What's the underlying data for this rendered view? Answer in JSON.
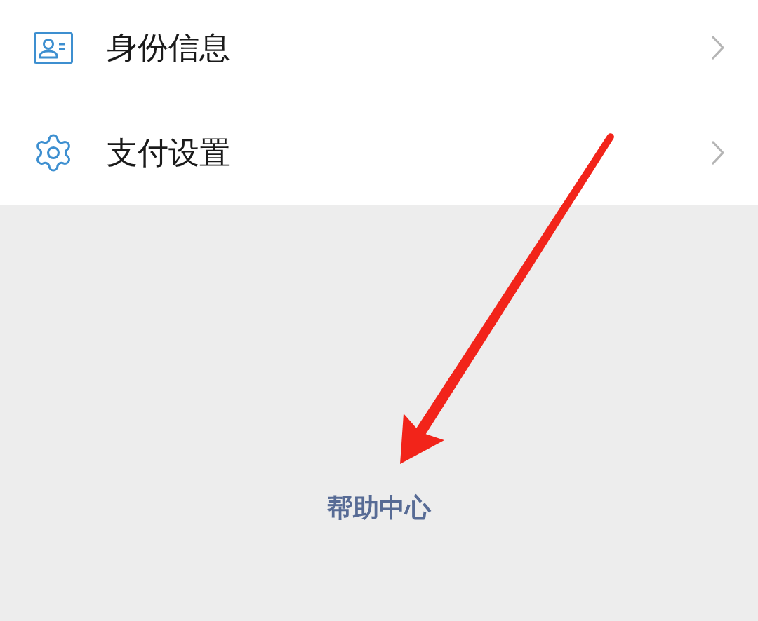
{
  "menu_items": [
    {
      "kind": "id-card",
      "label": "身份信息"
    },
    {
      "kind": "settings",
      "label": "支付设置"
    }
  ],
  "help_link": {
    "label": "帮助中心"
  }
}
